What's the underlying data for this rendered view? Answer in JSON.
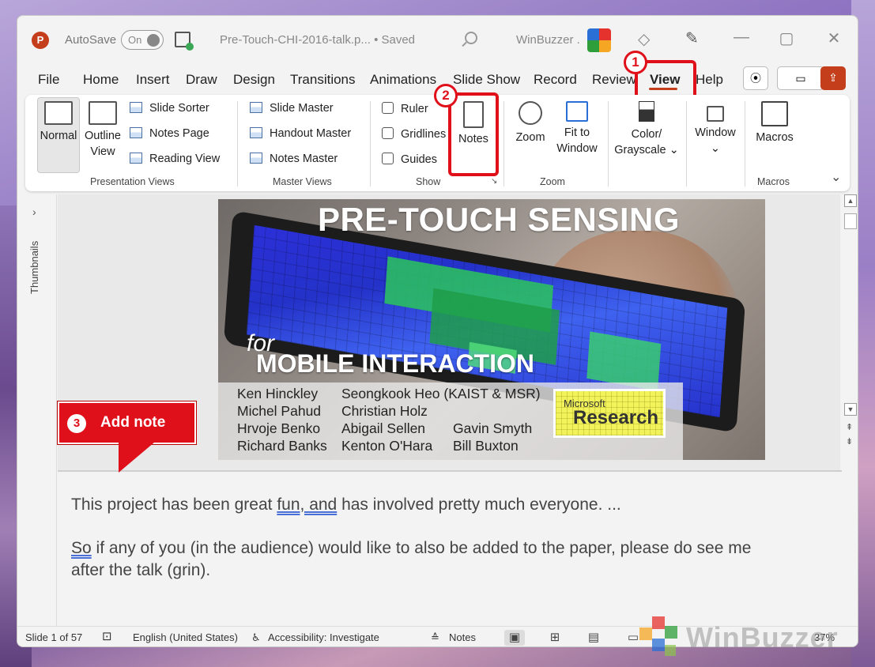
{
  "titlebar": {
    "autosave_label": "AutoSave",
    "toggle_state": "On",
    "doc_title": "Pre-Touch-CHI-2016-talk.p... • Saved",
    "user_name": "WinBuzzer .",
    "minimize": "—",
    "restore": "▢",
    "close": "✕"
  },
  "menu": {
    "tabs": [
      "File",
      "Home",
      "Insert",
      "Draw",
      "Design",
      "Transitions",
      "Animations",
      "Slide Show",
      "Record",
      "Review",
      "View",
      "Help"
    ],
    "active": "View"
  },
  "badges": {
    "step1": "1",
    "step2": "2"
  },
  "ribbon": {
    "presentation_views": {
      "label": "Presentation Views",
      "normal": "Normal",
      "outline_line1": "Outline",
      "outline_line2": "View",
      "slide_sorter": "Slide Sorter",
      "notes_page": "Notes Page",
      "reading_view": "Reading View"
    },
    "master_views": {
      "label": "Master Views",
      "slide_master": "Slide Master",
      "handout_master": "Handout Master",
      "notes_master": "Notes Master"
    },
    "show": {
      "label": "Show",
      "ruler": "Ruler",
      "gridlines": "Gridlines",
      "guides": "Guides",
      "notes": "Notes"
    },
    "zoom": {
      "label": "Zoom",
      "zoom": "Zoom",
      "fit_line1": "Fit to",
      "fit_line2": "Window"
    },
    "color": {
      "line1": "Color/",
      "line2": "Grayscale ⌄"
    },
    "window": {
      "label": "Window",
      "arrow": "⌄"
    },
    "macros": {
      "label": "Macros",
      "button": "Macros"
    },
    "collapse": "⌄"
  },
  "thumbnails": {
    "label": "Thumbnails",
    "chevron": "›"
  },
  "slide": {
    "title": "PRE-TOUCH SENSING",
    "for": "for",
    "subtitle": "MOBILE INTERACTION",
    "authors_col1": [
      "Ken Hinckley",
      "Michel Pahud",
      "Hrvoje Benko",
      "Richard Banks"
    ],
    "authors_col2": [
      "Seongkook Heo (KAIST & MSR)",
      "Christian Holz",
      "Abigail Sellen",
      "Kenton O'Hara"
    ],
    "authors_col3": [
      "Gavin Smyth",
      "Bill Buxton"
    ],
    "logo_line1": "Microsoft",
    "logo_line2": "Research"
  },
  "callout": {
    "number": "3",
    "text": "Add note"
  },
  "notes": {
    "line1_a": "This project has been great ",
    "line1_b": "fun, and",
    "line1_c": " has involved pretty much everyone. ...",
    "line2_a": "So",
    "line2_b": " if any of you (in the audience) would like to also be added to the paper, please do see me",
    "line3": "after the talk (grin)."
  },
  "status": {
    "slide_info": "Slide 1 of 57",
    "language": "English (United States)",
    "accessibility": "Accessibility: Investigate",
    "notes_btn": "Notes",
    "zoom_level": "37%"
  },
  "watermark": "WinBuzzer"
}
